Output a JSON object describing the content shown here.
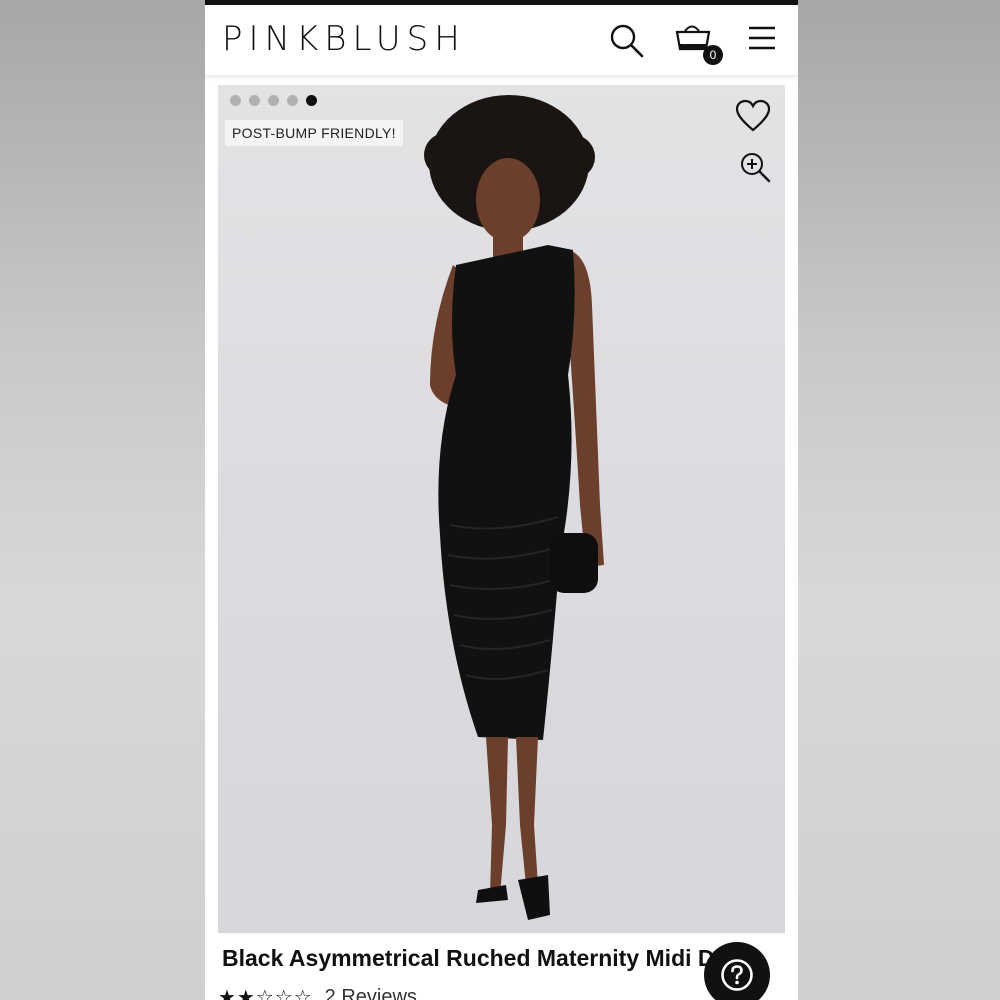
{
  "header": {
    "logo": "PINKBLUSH",
    "cart_count": "0"
  },
  "gallery": {
    "slide_count": 5,
    "active_slide": 5,
    "promo_badge": "POST-BUMP FRIENDLY!"
  },
  "product": {
    "title": "Black Asymmetrical Ruched Maternity Midi Dress",
    "rating_stars": "★★☆☆☆",
    "rating": 2,
    "reviews_text": "2 Reviews"
  },
  "icons": {
    "search": "search-icon",
    "cart": "shopping-bag-icon",
    "menu": "hamburger-menu-icon",
    "wishlist": "heart-icon",
    "zoom": "zoom-in-icon",
    "help": "question-mark-icon"
  },
  "colors": {
    "accent": "#111111",
    "photo_background": "#dcdbdf"
  }
}
